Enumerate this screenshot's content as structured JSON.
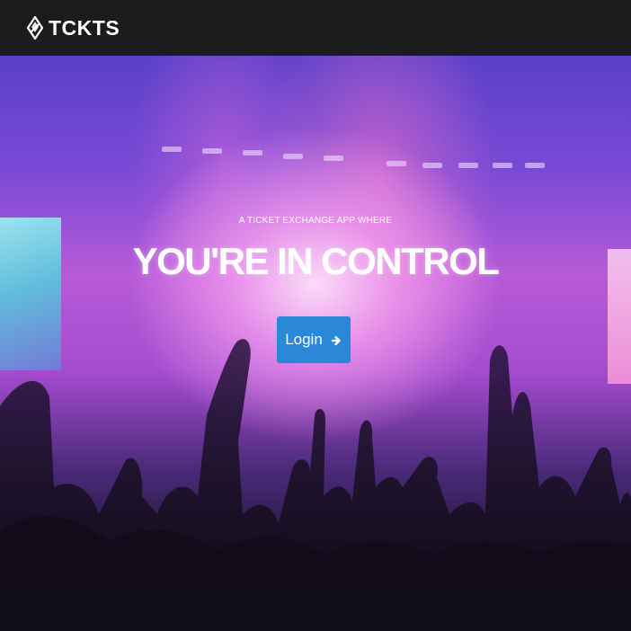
{
  "navbar": {
    "brand_name": "TCKTS",
    "brand_icon": "ticket-diamond-icon",
    "background": "#1b1c1e"
  },
  "hero": {
    "tagline": "A TICKET EXCHANGE APP WHERE",
    "headline": "YOU'RE IN CONTROL",
    "login_label": "Login",
    "login_icon": "arrow-circle-right-icon",
    "accent_color": "#2b88d8"
  }
}
